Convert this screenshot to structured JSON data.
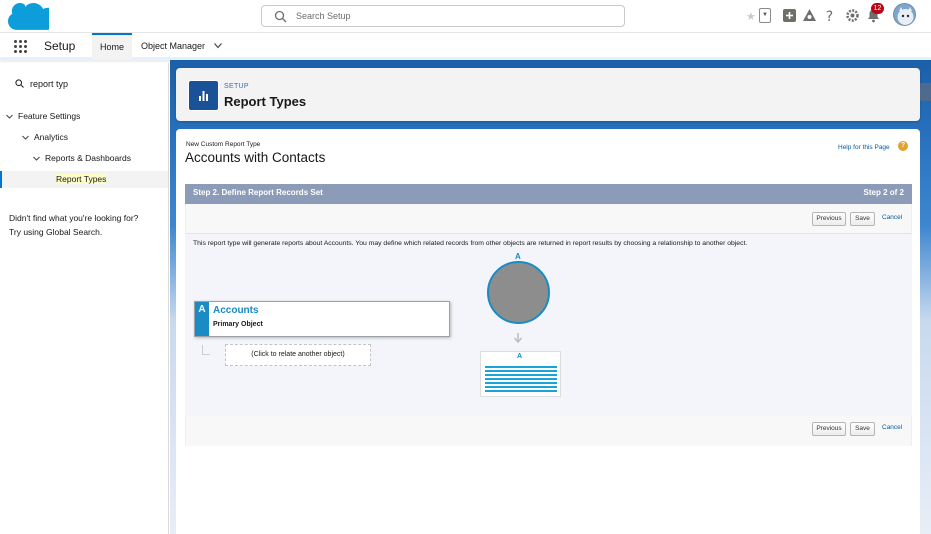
{
  "header": {
    "search_placeholder": "Search Setup",
    "notifications_count": "12"
  },
  "nav": {
    "app_name": "Setup",
    "tabs": [
      {
        "label": "Home"
      },
      {
        "label": "Object Manager"
      }
    ]
  },
  "sidebar": {
    "quick_find_value": "report typ",
    "tree": [
      {
        "label": "Feature Settings"
      },
      {
        "label": "Analytics"
      },
      {
        "label": "Reports & Dashboards"
      },
      {
        "label": "Report Types"
      }
    ],
    "help_line1": "Didn't find what you're looking for?",
    "help_line2": "Try using Global Search."
  },
  "page_header": {
    "eyebrow": "SETUP",
    "title": "Report Types"
  },
  "content": {
    "small_label": "New Custom Report Type",
    "record_title": "Accounts with Contacts",
    "help_link": "Help for this Page",
    "help_icon": "?",
    "step_title": "Step 2. Define Report Records Set",
    "step_count": "Step 2 of 2",
    "buttons": {
      "previous": "Previous",
      "save": "Save",
      "cancel": "Cancel"
    },
    "description": "This report type will generate reports about Accounts. You may define which related records from other objects are returned in report results by choosing a relationship to another object.",
    "primary_object": {
      "letter": "A",
      "name": "Accounts",
      "subtitle": "Primary Object"
    },
    "relate_placeholder": "(Click to relate another object)",
    "diagram": {
      "top_letter": "A",
      "table_letter": "A"
    }
  },
  "colors": {
    "brand": "#0176d3",
    "object_blue": "#1a8bc4",
    "step_bar": "#8c9cb8"
  }
}
